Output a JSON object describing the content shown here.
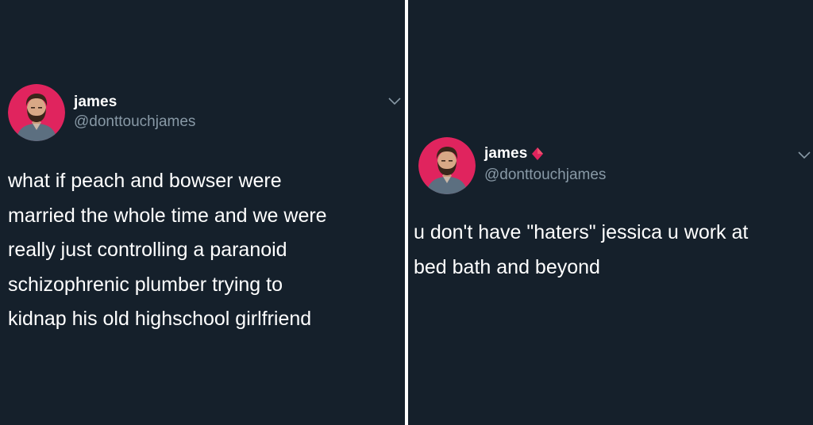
{
  "colors": {
    "background": "#15202b",
    "divider": "#ffffff",
    "text_primary": "#ffffff",
    "text_secondary": "#8899a6",
    "avatar_ring": "#e0245e",
    "diamond": "#e0245e"
  },
  "tweets": [
    {
      "author": {
        "display_name": "james",
        "handle": "@donttouchjames",
        "avatar_icon": "avatar-man-beard",
        "badge_icon": ""
      },
      "menu_icon": "chevron-down-icon",
      "text": "what if peach and bowser were\nmarried the whole time and we were\nreally just controlling a paranoid\nschizophrenic plumber trying to\nkidnap his old highschool girlfriend"
    },
    {
      "author": {
        "display_name": "james",
        "handle": "@donttouchjames",
        "avatar_icon": "avatar-man-beard",
        "badge_icon": "red-diamond-icon"
      },
      "menu_icon": "chevron-down-icon",
      "text": "u don't have \"haters\" jessica u work at\nbed bath and beyond"
    }
  ]
}
